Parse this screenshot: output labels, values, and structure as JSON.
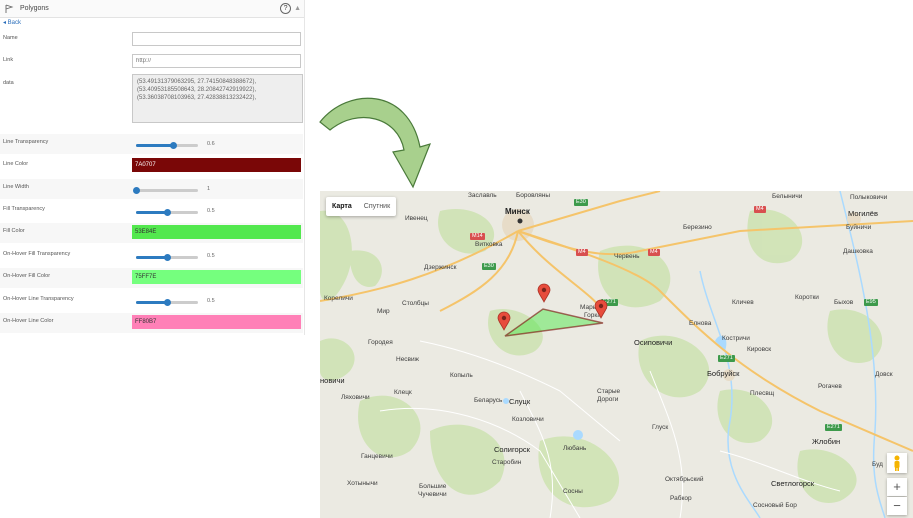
{
  "panel": {
    "title": "Polygons",
    "help": "?",
    "collapse": "▲",
    "back_label": "◂ Back",
    "name_label": "Name",
    "name_value": "",
    "link_label": "Link",
    "link_placeholder": "http://",
    "data_label": "data",
    "data_lines": [
      "(53.49131379063295, 27.74150848388672),",
      "(53.40953185508643, 28.20842742919922),",
      "(53.36038708103963, 27.42838813232422),"
    ],
    "line_transparency_label": "Line Transparency",
    "line_transparency_value": "0.6",
    "line_transparency_level": 0.6,
    "line_color_label": "Line Color",
    "line_color_value": "7A0707",
    "line_width_label": "Line Width",
    "line_width_value": "1",
    "line_width_level": 0.0,
    "fill_transparency_label": "Fill Transparency",
    "fill_transparency_value": "0.5",
    "fill_transparency_level": 0.5,
    "fill_color_label": "Fill Color",
    "fill_color_value": "53E84E",
    "hover_fill_transparency_label": "On-Hover Fill Transparency",
    "hover_fill_transparency_value": "0.5",
    "hover_fill_transparency_level": 0.5,
    "hover_fill_color_label": "On-Hover Fill Color",
    "hover_fill_color_value": "75FF7E",
    "hover_line_transparency_label": "On-Hover Line Transparency",
    "hover_line_transparency_value": "0.5",
    "hover_line_transparency_level": 0.5,
    "hover_line_color_label": "On-Hover Line Color",
    "hover_line_color_value": "FF80B7"
  },
  "colors": {
    "line_color": "#7A0707",
    "fill_color": "#53E84E",
    "hover_fill_color": "#75FF7E",
    "hover_line_color": "#FF80B7",
    "slider_accent": "#2d7bc0",
    "arrow_fill": "#a8d08d",
    "arrow_stroke": "#4a7a3a"
  },
  "map": {
    "tab_map": "Карта",
    "tab_satellite": "Спутник",
    "zoom_in": "+",
    "zoom_out": "−",
    "labels": {
      "minsk": "Минск",
      "zaslavl": "Заславль",
      "borovlyany": "Боровляны",
      "belynichi": "Белыничи",
      "polykovichi": "Полыковичи",
      "ivenets": "Ивенец",
      "berezino": "Березино",
      "mogilev": "Могилёв",
      "buinichi": "Буйничи",
      "vitkovka": "Витковка",
      "cherven": "Червень",
      "dashkovka": "Дашковка",
      "dzerzhinsk": "Дзержинск",
      "korelichi": "Кореличи",
      "stolbtsy": "Столбцы",
      "mir": "Мир",
      "maryina_gorka_1": "Марьина",
      "maryina_gorka_2": "Горка",
      "klichev": "Кличев",
      "korotkiye": "Коротки",
      "bykhov": "Быхов",
      "yelnovo": "Елнова",
      "osipovichi": "Осиповичи",
      "kostrichi": "Костричи",
      "kirovsk": "Кировск",
      "gorodeya": "Городея",
      "nesvizh": "Несвиж",
      "bobruisk": "Бобруйск",
      "novovichi": "новичи",
      "kopyl": "Копыль",
      "lyakhovichi": "Ляховичи",
      "kletsk": "Клецк",
      "belaruss": "Беларусь",
      "slutsk": "Слуцк",
      "starye_dorogi_1": "Старые",
      "starye_dorogi_2": "Дороги",
      "ploschevo": "Плесвщ",
      "rogachev": "Рогачев",
      "dovsk": "Довск",
      "kozlovichi": "Козловичи",
      "glusk": "Глуск",
      "zhlobin": "Жлобин",
      "gantsevichi": "Ганцевичи",
      "soligorsk": "Солигорск",
      "lyuban": "Любань",
      "starobin": "Старобин",
      "khotynichi": "Хотынычи",
      "bolshie_chuchevichi_1": "Большие",
      "bolshie_chuchevichi_2": "Чучевичи",
      "sosny": "Сосны",
      "oktyabrskiy": "Октябрьский",
      "svetlogorsk": "Светлогорск",
      "rabkor": "Рабкор",
      "sosnovy_bor": "Сосновый Бор",
      "buda": "Буд"
    },
    "roads": {
      "e30a": "E30",
      "e30b": "E30",
      "m14": "M14",
      "m4a": "M4",
      "m4b": "M4",
      "m4c": "M4",
      "e271a": "E271",
      "e271b": "E271",
      "e271c": "E271",
      "e95": "E95",
      "p2": "P2"
    }
  }
}
